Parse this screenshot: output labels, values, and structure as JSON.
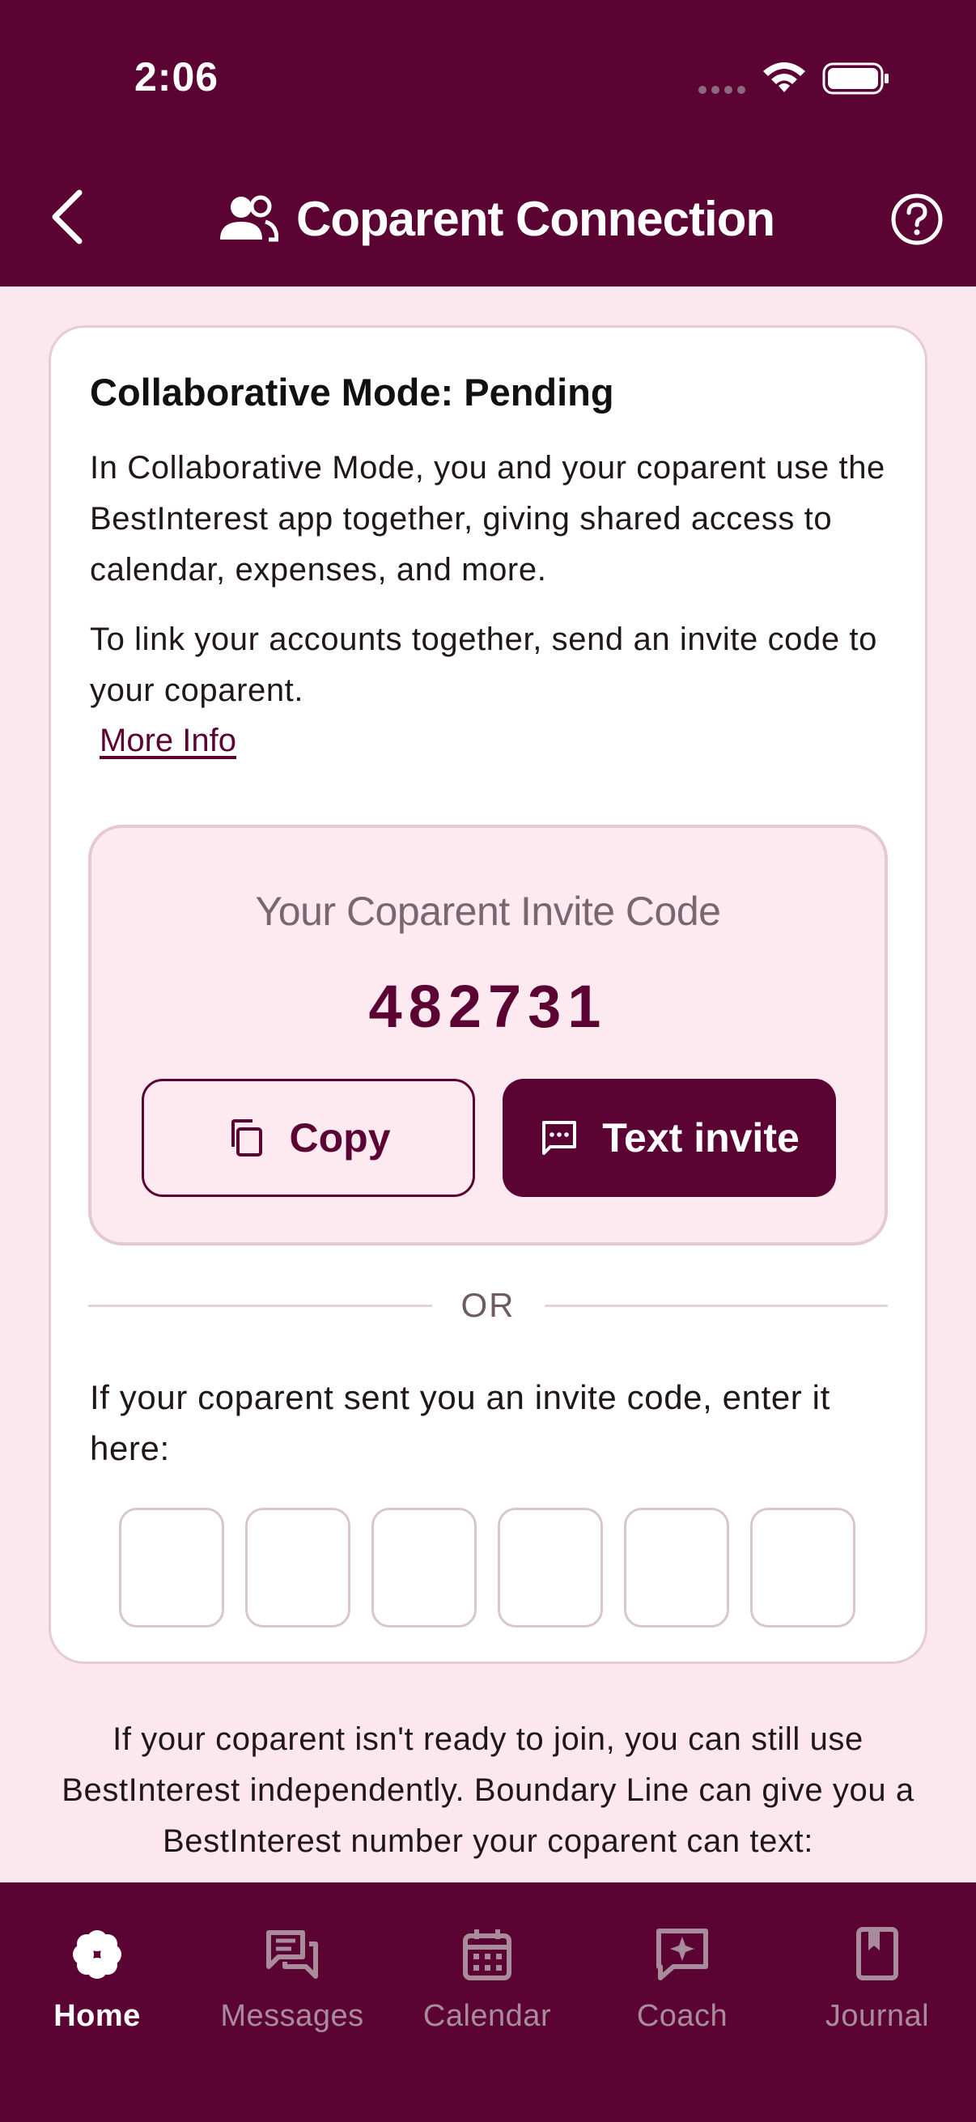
{
  "status_bar": {
    "time": "2:06"
  },
  "header": {
    "title": "Coparent Connection"
  },
  "card": {
    "title": "Collaborative Mode: Pending",
    "paragraph1": "In Collaborative Mode, you and your coparent use the BestInterest app together, giving shared access to calendar, expenses, and more.",
    "paragraph2": "To link your accounts together, send an invite code to your coparent.",
    "more_info": "More Info",
    "invite": {
      "label": "Your Coparent Invite Code",
      "code": "482731",
      "copy_label": "Copy",
      "text_invite_label": "Text invite"
    },
    "or_text": "OR",
    "enter_prompt": "If your coparent sent you an invite code, enter it here:",
    "code_inputs": [
      "",
      "",
      "",
      "",
      "",
      ""
    ]
  },
  "independent_text": "If your coparent isn't ready to join, you can still use BestInterest independently. Boundary Line can give you a BestInterest number your coparent can text:",
  "bottom_nav": {
    "items": [
      {
        "label": "Home",
        "icon": "clover-icon",
        "active": true
      },
      {
        "label": "Messages",
        "icon": "messages-icon",
        "active": false
      },
      {
        "label": "Calendar",
        "icon": "calendar-icon",
        "active": false
      },
      {
        "label": "Coach",
        "icon": "coach-sparkle-icon",
        "active": false
      },
      {
        "label": "Journal",
        "icon": "journal-icon",
        "active": false
      }
    ]
  },
  "colors": {
    "brand": "#5b0434",
    "background": "#fde7ee",
    "invite_box": "#fde9f0",
    "nav_inactive": "#a98c9b"
  }
}
